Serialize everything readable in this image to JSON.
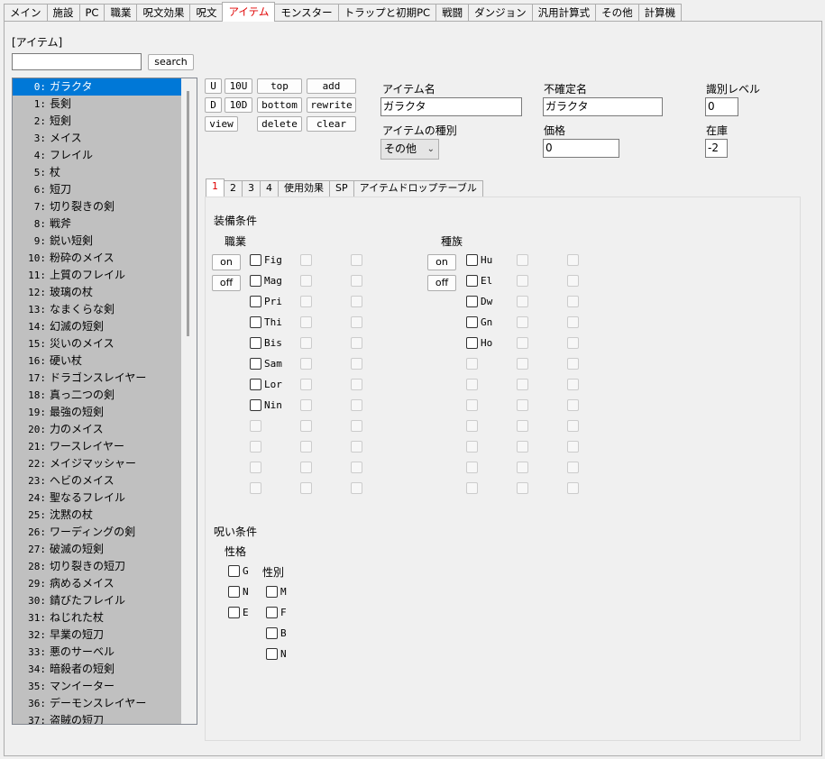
{
  "tabs": [
    "メイン",
    "施設",
    "PC",
    "職業",
    "呪文効果",
    "呪文",
    "アイテム",
    "モンスター",
    "トラップと初期PC",
    "戦闘",
    "ダンジョン",
    "汎用計算式",
    "その他",
    "計算機"
  ],
  "active_tab": 6,
  "section_label": "[アイテム]",
  "search": {
    "value": "",
    "button": "search"
  },
  "items": [
    {
      "num": "0:",
      "name": "ガラクタ"
    },
    {
      "num": "1:",
      "name": "長剣"
    },
    {
      "num": "2:",
      "name": "短剣"
    },
    {
      "num": "3:",
      "name": "メイス"
    },
    {
      "num": "4:",
      "name": "フレイル"
    },
    {
      "num": "5:",
      "name": "杖"
    },
    {
      "num": "6:",
      "name": "短刀"
    },
    {
      "num": "7:",
      "name": "切り裂きの剣"
    },
    {
      "num": "8:",
      "name": "戦斧"
    },
    {
      "num": "9:",
      "name": "鋭い短剣"
    },
    {
      "num": "10:",
      "name": "粉砕のメイス"
    },
    {
      "num": "11:",
      "name": "上質のフレイル"
    },
    {
      "num": "12:",
      "name": "玻璃の杖"
    },
    {
      "num": "13:",
      "name": "なまくらな剣"
    },
    {
      "num": "14:",
      "name": "幻滅の短剣"
    },
    {
      "num": "15:",
      "name": "災いのメイス"
    },
    {
      "num": "16:",
      "name": "硬い杖"
    },
    {
      "num": "17:",
      "name": "ドラゴンスレイヤー"
    },
    {
      "num": "18:",
      "name": "真っ二つの剣"
    },
    {
      "num": "19:",
      "name": "最強の短剣"
    },
    {
      "num": "20:",
      "name": "力のメイス"
    },
    {
      "num": "21:",
      "name": "ワースレイヤー"
    },
    {
      "num": "22:",
      "name": "メイジマッシャー"
    },
    {
      "num": "23:",
      "name": "ヘビのメイス"
    },
    {
      "num": "24:",
      "name": "聖なるフレイル"
    },
    {
      "num": "25:",
      "name": "沈黙の杖"
    },
    {
      "num": "26:",
      "name": "ワーディングの剣"
    },
    {
      "num": "27:",
      "name": "破滅の短剣"
    },
    {
      "num": "28:",
      "name": "切り裂きの短刀"
    },
    {
      "num": "29:",
      "name": "病めるメイス"
    },
    {
      "num": "30:",
      "name": "錆びたフレイル"
    },
    {
      "num": "31:",
      "name": "ねじれた杖"
    },
    {
      "num": "32:",
      "name": "早業の短刀"
    },
    {
      "num": "33:",
      "name": "悪のサーベル"
    },
    {
      "num": "34:",
      "name": "暗殺者の短剣"
    },
    {
      "num": "35:",
      "name": "マンイーター"
    },
    {
      "num": "36:",
      "name": "デーモンスレイヤー"
    },
    {
      "num": "37:",
      "name": "盗賊の短刀"
    }
  ],
  "selected_index": 0,
  "nav_buttons": {
    "up": "U",
    "up10": "10U",
    "top": "top",
    "add": "add",
    "down": "D",
    "down10": "10D",
    "bottom": "bottom",
    "rewrite": "rewrite",
    "view": "view",
    "delete": "delete",
    "clear": "clear"
  },
  "fields": {
    "item_name_label": "アイテム名",
    "item_name": "ガラクタ",
    "uncertain_name_label": "不確定名",
    "uncertain_name": "ガラクタ",
    "ident_level_label": "識別レベル",
    "ident_level": "0",
    "item_type_label": "アイテムの種別",
    "item_type": "その他",
    "price_label": "価格",
    "price": "0",
    "stock_label": "在庫",
    "stock": "-2"
  },
  "subtabs": [
    "1",
    "2",
    "3",
    "4",
    "使用効果",
    "SP",
    "アイテムドロップテーブル"
  ],
  "active_subtab": 0,
  "equip": {
    "title": "装備条件",
    "class_label": "職業",
    "race_label": "種族",
    "on": "on",
    "off": "off",
    "classes": [
      "Fig",
      "Mag",
      "Pri",
      "Thi",
      "Bis",
      "Sam",
      "Lor",
      "Nin"
    ],
    "races": [
      "Hu",
      "El",
      "Dw",
      "Gn",
      "Ho"
    ]
  },
  "curse": {
    "title": "呪い条件",
    "alignment_label": "性格",
    "sex_label": "性別",
    "alignments": [
      "G",
      "N",
      "E"
    ],
    "sexes": [
      "M",
      "F",
      "B",
      "N"
    ]
  }
}
